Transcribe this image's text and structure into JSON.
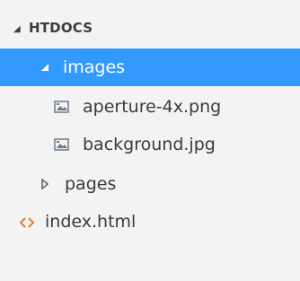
{
  "explorer": {
    "section_header": "HTDOCS",
    "items": [
      {
        "label": "images",
        "type": "folder",
        "expanded": true,
        "selected": true,
        "icon": "folder-expanded-caret-icon"
      },
      {
        "label": "aperture-4x.png",
        "type": "file",
        "icon": "image-file-icon"
      },
      {
        "label": "background.jpg",
        "type": "file",
        "icon": "image-file-icon"
      },
      {
        "label": "pages",
        "type": "folder",
        "expanded": false,
        "icon": "folder-collapsed-caret-icon"
      },
      {
        "label": "index.html",
        "type": "file",
        "icon": "html-file-icon"
      }
    ]
  },
  "colors": {
    "background": "#f3f3f3",
    "selection": "#3399ff",
    "text": "#3a3a3a",
    "selected_text": "#ffffff",
    "html_icon": "#e37933",
    "image_icon": "#6c7a89"
  }
}
